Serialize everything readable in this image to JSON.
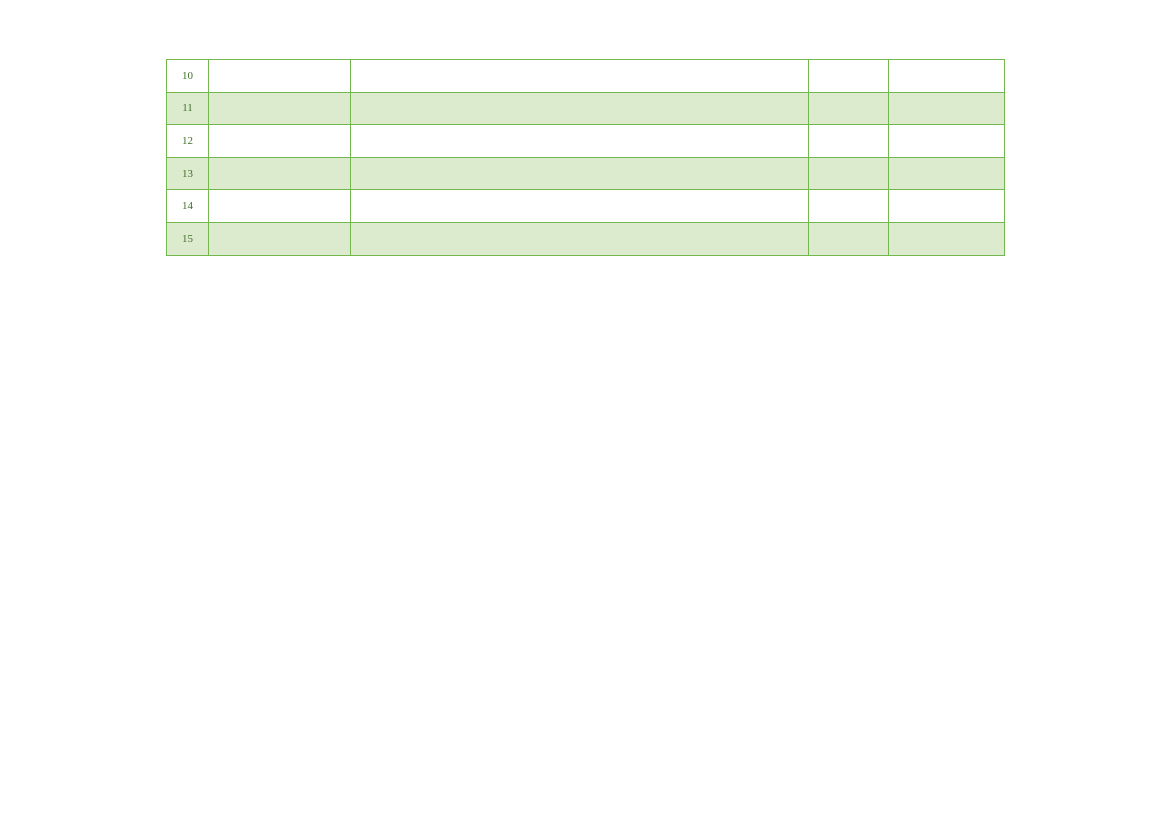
{
  "table": {
    "rows": [
      {
        "num": "10",
        "c2": "",
        "c3": "",
        "c4": "",
        "c5": ""
      },
      {
        "num": "11",
        "c2": "",
        "c3": "",
        "c4": "",
        "c5": ""
      },
      {
        "num": "12",
        "c2": "",
        "c3": "",
        "c4": "",
        "c5": ""
      },
      {
        "num": "13",
        "c2": "",
        "c3": "",
        "c4": "",
        "c5": ""
      },
      {
        "num": "14",
        "c2": "",
        "c3": "",
        "c4": "",
        "c5": ""
      },
      {
        "num": "15",
        "c2": "",
        "c3": "",
        "c4": "",
        "c5": ""
      }
    ]
  }
}
